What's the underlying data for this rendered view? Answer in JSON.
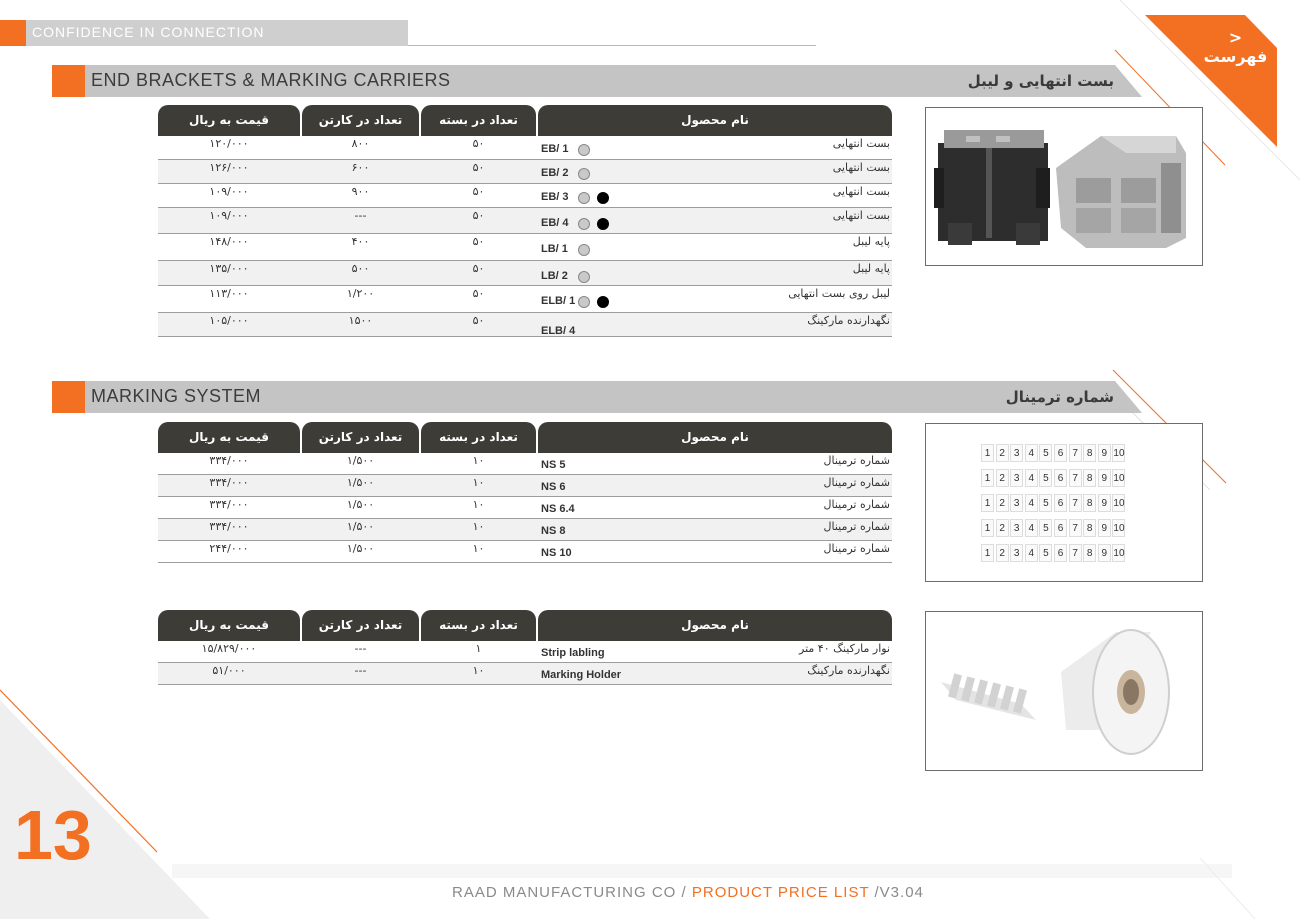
{
  "header": {
    "tagline": "CONFIDENCE IN CONNECTION",
    "menu_label": "< فهرست"
  },
  "columns": {
    "price": "قیمت به ریال",
    "carton": "تعداد در کارتن",
    "pack": "تعداد در بسته",
    "name": "نام محصول"
  },
  "section1": {
    "title_en": "END BRACKETS & MARKING CARRIERS",
    "title_fa": "بست انتهایی و لیبل",
    "rows": [
      {
        "price": "۱۲۰/۰۰۰",
        "carton": "۸۰۰",
        "pack": "۵۰",
        "name": "بست انتهایی",
        "code": "EB/ 1",
        "dots": [
          "gray"
        ]
      },
      {
        "price": "۱۲۶/۰۰۰",
        "carton": "۶۰۰",
        "pack": "۵۰",
        "name": "بست انتهایی",
        "code": "EB/ 2",
        "dots": [
          "gray"
        ]
      },
      {
        "price": "۱۰۹/۰۰۰",
        "carton": "۹۰۰",
        "pack": "۵۰",
        "name": "بست انتهایی",
        "code": "EB/ 3",
        "dots": [
          "gray",
          "black"
        ]
      },
      {
        "price": "۱۰۹/۰۰۰",
        "carton": "---",
        "pack": "۵۰",
        "name": "بست انتهایی",
        "code": "EB/ 4",
        "dots": [
          "gray",
          "black"
        ]
      },
      {
        "price": "۱۴۸/۰۰۰",
        "carton": "۴۰۰",
        "pack": "۵۰",
        "name": "پایه لیبل",
        "code": "LB/ 1",
        "dots": [
          "gray"
        ]
      },
      {
        "price": "۱۳۵/۰۰۰",
        "carton": "۵۰۰",
        "pack": "۵۰",
        "name": "پایه لیبل",
        "code": "LB/ 2",
        "dots": [
          "gray"
        ]
      },
      {
        "price": "۱۱۳/۰۰۰",
        "carton": "۱/۲۰۰",
        "pack": "۵۰",
        "name": "لیبل روی بست انتهایی",
        "code": "ELB/ 1",
        "dots": [
          "gray",
          "black"
        ]
      },
      {
        "price": "۱۰۵/۰۰۰",
        "carton": "۱۵۰۰",
        "pack": "۵۰",
        "name": "نگهدارنده مارکینگ",
        "code": "ELB/ 4",
        "dots": []
      }
    ]
  },
  "section2": {
    "title_en": "MARKING SYSTEM",
    "title_fa": "شماره ترمینال",
    "rows": [
      {
        "price": "۳۳۴/۰۰۰",
        "carton": "۱/۵۰۰",
        "pack": "۱۰",
        "name": "شماره ترمینال",
        "code": "NS 5"
      },
      {
        "price": "۳۳۴/۰۰۰",
        "carton": "۱/۵۰۰",
        "pack": "۱۰",
        "name": "شماره ترمینال",
        "code": "NS 6"
      },
      {
        "price": "۳۳۴/۰۰۰",
        "carton": "۱/۵۰۰",
        "pack": "۱۰",
        "name": "شماره ترمینال",
        "code": "NS 6.4"
      },
      {
        "price": "۳۳۴/۰۰۰",
        "carton": "۱/۵۰۰",
        "pack": "۱۰",
        "name": "شماره ترمینال",
        "code": "NS 8"
      },
      {
        "price": "۲۴۴/۰۰۰",
        "carton": "۱/۵۰۰",
        "pack": "۱۰",
        "name": "شماره ترمینال",
        "code": "NS 10"
      }
    ]
  },
  "section3": {
    "rows": [
      {
        "price": "۱۵/۸۲۹/۰۰۰",
        "carton": "---",
        "pack": "۱",
        "name": "نوار مارکینگ ۴۰ متر",
        "code": "Strip labling"
      },
      {
        "price": "۵۱/۰۰۰",
        "carton": "---",
        "pack": "۱۰",
        "name": "نگهدارنده مارکینگ",
        "code": "Marking Holder"
      }
    ]
  },
  "marker_numbers": [
    "1",
    "2",
    "3",
    "4",
    "5",
    "6",
    "7",
    "8",
    "9",
    "10"
  ],
  "footer": {
    "page_number": "13",
    "company": "RAAD MANUFACTURING CO / ",
    "doc": "PRODUCT PRICE LIST",
    "version": " /V3.04"
  },
  "colors": {
    "accent": "#f36f21",
    "header_dark": "#3d3c37",
    "bar_gray": "#c4c4c4"
  }
}
